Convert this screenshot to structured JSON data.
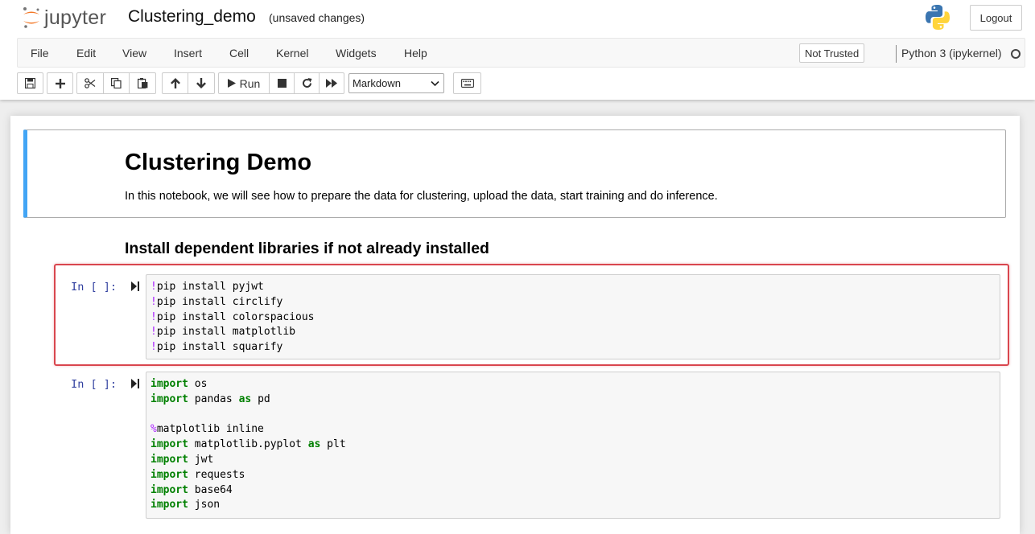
{
  "header": {
    "logo_text": "jupyter",
    "notebook_name": "Clustering_demo",
    "autosave_status": "(unsaved changes)",
    "logout_label": "Logout"
  },
  "menubar": {
    "items": [
      "File",
      "Edit",
      "View",
      "Insert",
      "Cell",
      "Kernel",
      "Widgets",
      "Help"
    ],
    "trust_label": "Not Trusted",
    "kernel_name": "Python 3 (ipykernel)"
  },
  "toolbar": {
    "run_label": "Run",
    "cell_type": "Markdown",
    "icons": [
      "save-icon",
      "plus-icon",
      "scissors-icon",
      "copy-icon",
      "paste-icon",
      "arrow-up-icon",
      "arrow-down-icon",
      "play-icon",
      "stop-icon",
      "restart-icon",
      "fast-forward-icon",
      "keyboard-icon"
    ]
  },
  "cells": [
    {
      "type": "markdown",
      "title": "Clustering Demo",
      "paragraph": "In this notebook, we will see how to prepare the data for clustering, upload the data, start training and do inference."
    },
    {
      "type": "markdown",
      "heading": "Install dependent libraries if not already installed"
    },
    {
      "type": "code",
      "prompt": "In [ ]:",
      "lines": [
        {
          "prefix": "!",
          "rest": "pip install pyjwt"
        },
        {
          "prefix": "!",
          "rest": "pip install circlify"
        },
        {
          "prefix": "!",
          "rest": "pip install colorspacious"
        },
        {
          "prefix": "!",
          "rest": "pip install matplotlib"
        },
        {
          "prefix": "!",
          "rest": "pip install squarify"
        }
      ]
    },
    {
      "type": "code",
      "prompt": "In [ ]:",
      "lines": [
        {
          "kw": "import",
          "rest": " os"
        },
        {
          "kw": "import",
          "rest": " pandas ",
          "kw2": "as",
          "rest2": " pd"
        },
        {
          "blank": true
        },
        {
          "magic": "%",
          "rest": "matplotlib inline"
        },
        {
          "kw": "import",
          "rest": " matplotlib.pyplot ",
          "kw2": "as",
          "rest2": " plt"
        },
        {
          "kw": "import",
          "rest": " jwt"
        },
        {
          "kw": "import",
          "rest": " requests"
        },
        {
          "kw": "import",
          "rest": " base64"
        },
        {
          "kw": "import",
          "rest": " json"
        }
      ]
    }
  ],
  "colors": {
    "selected_cell_bar": "#42a5f5",
    "highlight_box": "#d9464e",
    "keyword": "#008000",
    "magic": "#aa22ff",
    "prompt": "#303f9f"
  }
}
